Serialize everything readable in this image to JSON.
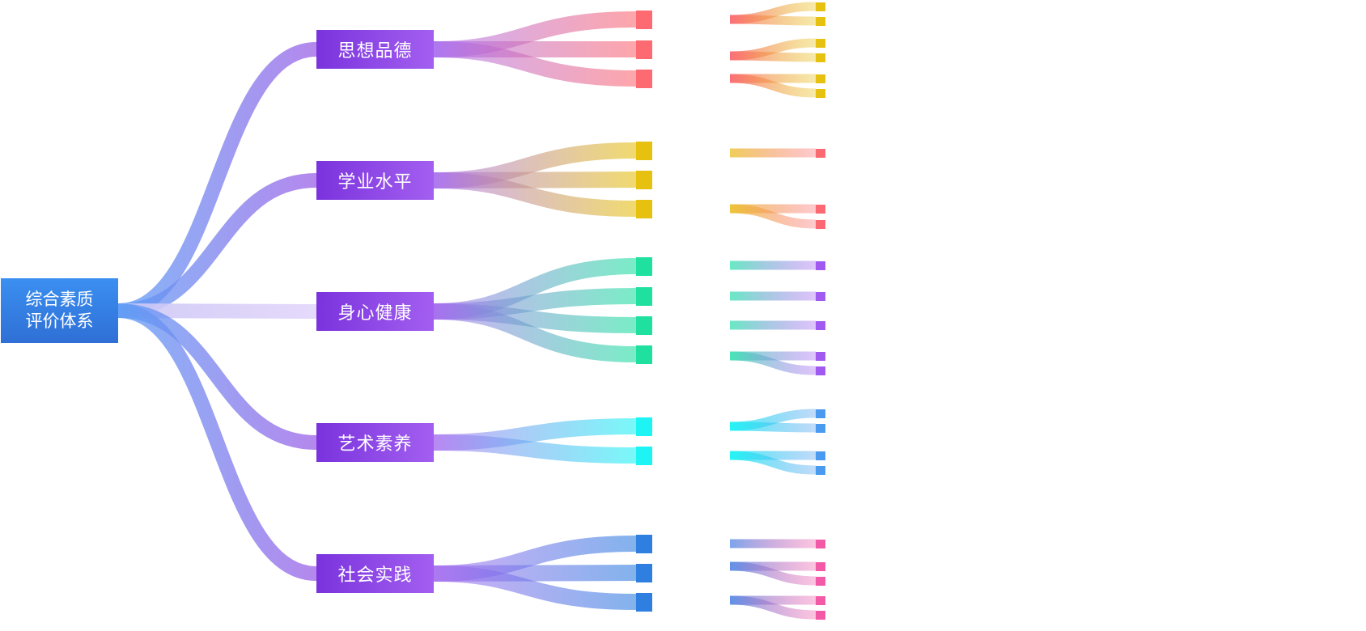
{
  "root": {
    "label": "综合素质\n评价体系"
  },
  "categories": [
    {
      "id": "c1",
      "label": "思想品德",
      "color": "#fd6a72",
      "count": 3
    },
    {
      "id": "c2",
      "label": "学业水平",
      "color": "#e6c10f",
      "count": 3
    },
    {
      "id": "c3",
      "label": "身心健康",
      "color": "#20e0a0",
      "count": 4
    },
    {
      "id": "c4",
      "label": "艺术素养",
      "color": "#1ef4f4",
      "count": 2
    },
    {
      "id": "c5",
      "label": "社会实践",
      "color": "#2f7fe0",
      "count": 3
    }
  ],
  "sub_groups": [
    {
      "from": "#fb6a72",
      "to": "#e6c10f",
      "children": 2
    },
    {
      "from": "#fb6a72",
      "to": "#e6c10f",
      "children": 2
    },
    {
      "from": "#fb6a72",
      "to": "#e6c10f",
      "children": 2
    },
    {
      "from": "#ecc230",
      "to": "#fb6a72",
      "children": 1
    },
    {
      "from": "#ecc230",
      "to": "#fb6a72",
      "children": 2
    },
    {
      "from": "#42e4b5",
      "to": "#a05af0",
      "children": 1
    },
    {
      "from": "#42e4b5",
      "to": "#a05af0",
      "children": 1
    },
    {
      "from": "#42e4b5",
      "to": "#a05af0",
      "children": 1
    },
    {
      "from": "#42e4b5",
      "to": "#a05af0",
      "children": 2
    },
    {
      "from": "#1ef4f4",
      "to": "#4a9bf0",
      "children": 2
    },
    {
      "from": "#1ef4f4",
      "to": "#4a9bf0",
      "children": 2
    },
    {
      "from": "#5b8ee6",
      "to": "#f25aa8",
      "children": 1
    },
    {
      "from": "#5b8ee6",
      "to": "#f25aa8",
      "children": 2
    },
    {
      "from": "#5b8ee6",
      "to": "#f25aa8",
      "children": 2
    }
  ],
  "colors": {
    "root": "#3389ee",
    "level1": "#8f47e8",
    "trunk_from": "#5b9cf5",
    "trunk_to": "#a26ae8"
  }
}
